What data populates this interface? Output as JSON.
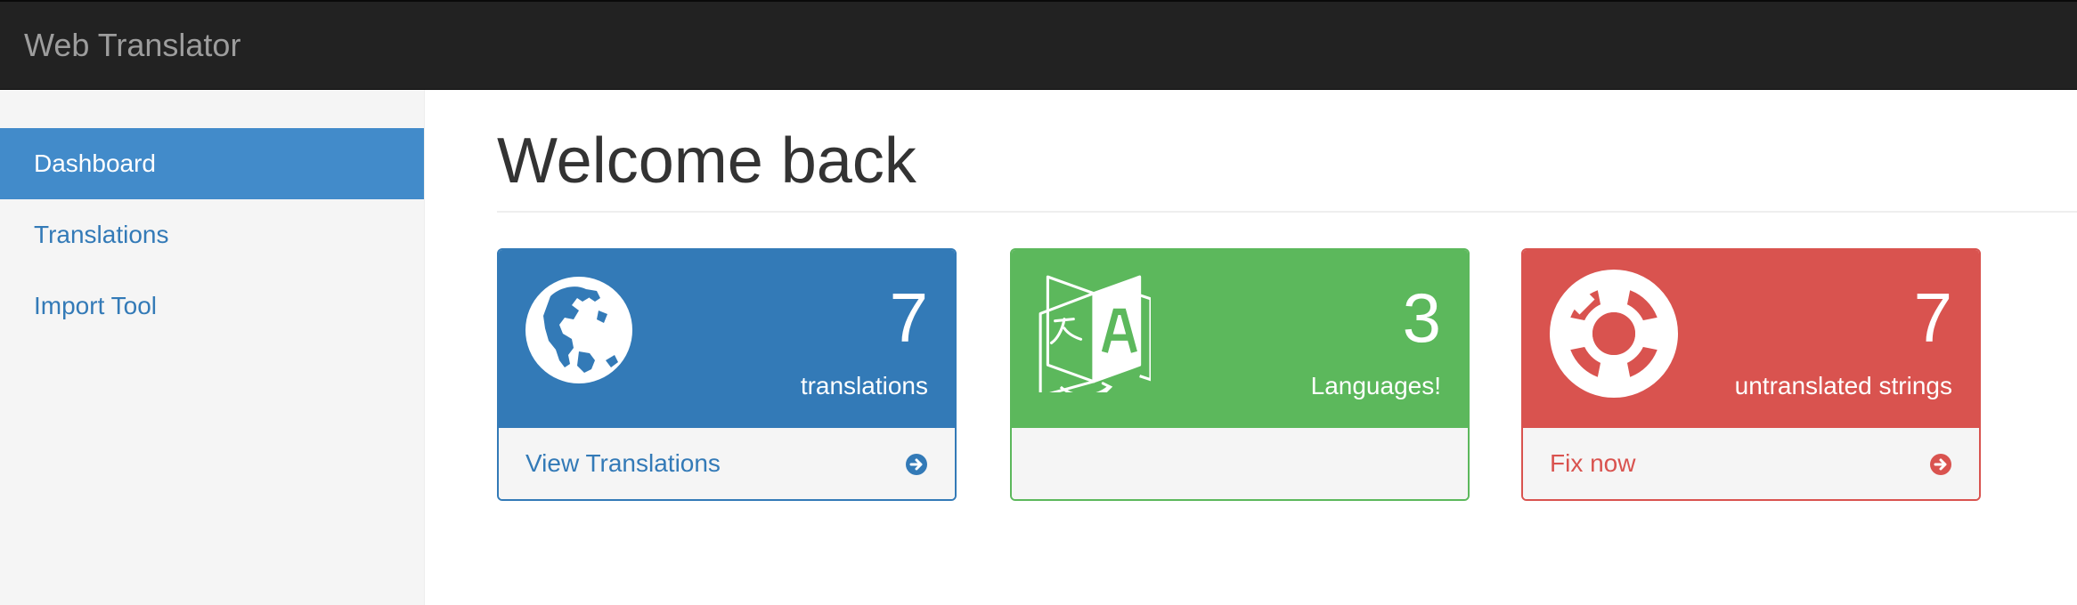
{
  "app": {
    "brand": "Web Translator"
  },
  "sidebar": {
    "items": [
      {
        "label": "Dashboard",
        "active": true
      },
      {
        "label": "Translations",
        "active": false
      },
      {
        "label": "Import Tool",
        "active": false
      }
    ]
  },
  "main": {
    "title": "Welcome back",
    "panels": [
      {
        "count": "7",
        "label": "translations",
        "link": "View Translations",
        "icon": "globe-icon",
        "color": "#337ab7"
      },
      {
        "count": "3",
        "label": "Languages!",
        "link": "",
        "icon": "language-icon",
        "color": "#5cb85c"
      },
      {
        "count": "7",
        "label": "untranslated strings",
        "link": "Fix now",
        "icon": "life-ring-icon",
        "color": "#d9534f"
      }
    ]
  },
  "colors": {
    "navbar": "#222222",
    "sidebar_active": "#428bca",
    "link": "#337ab7"
  }
}
